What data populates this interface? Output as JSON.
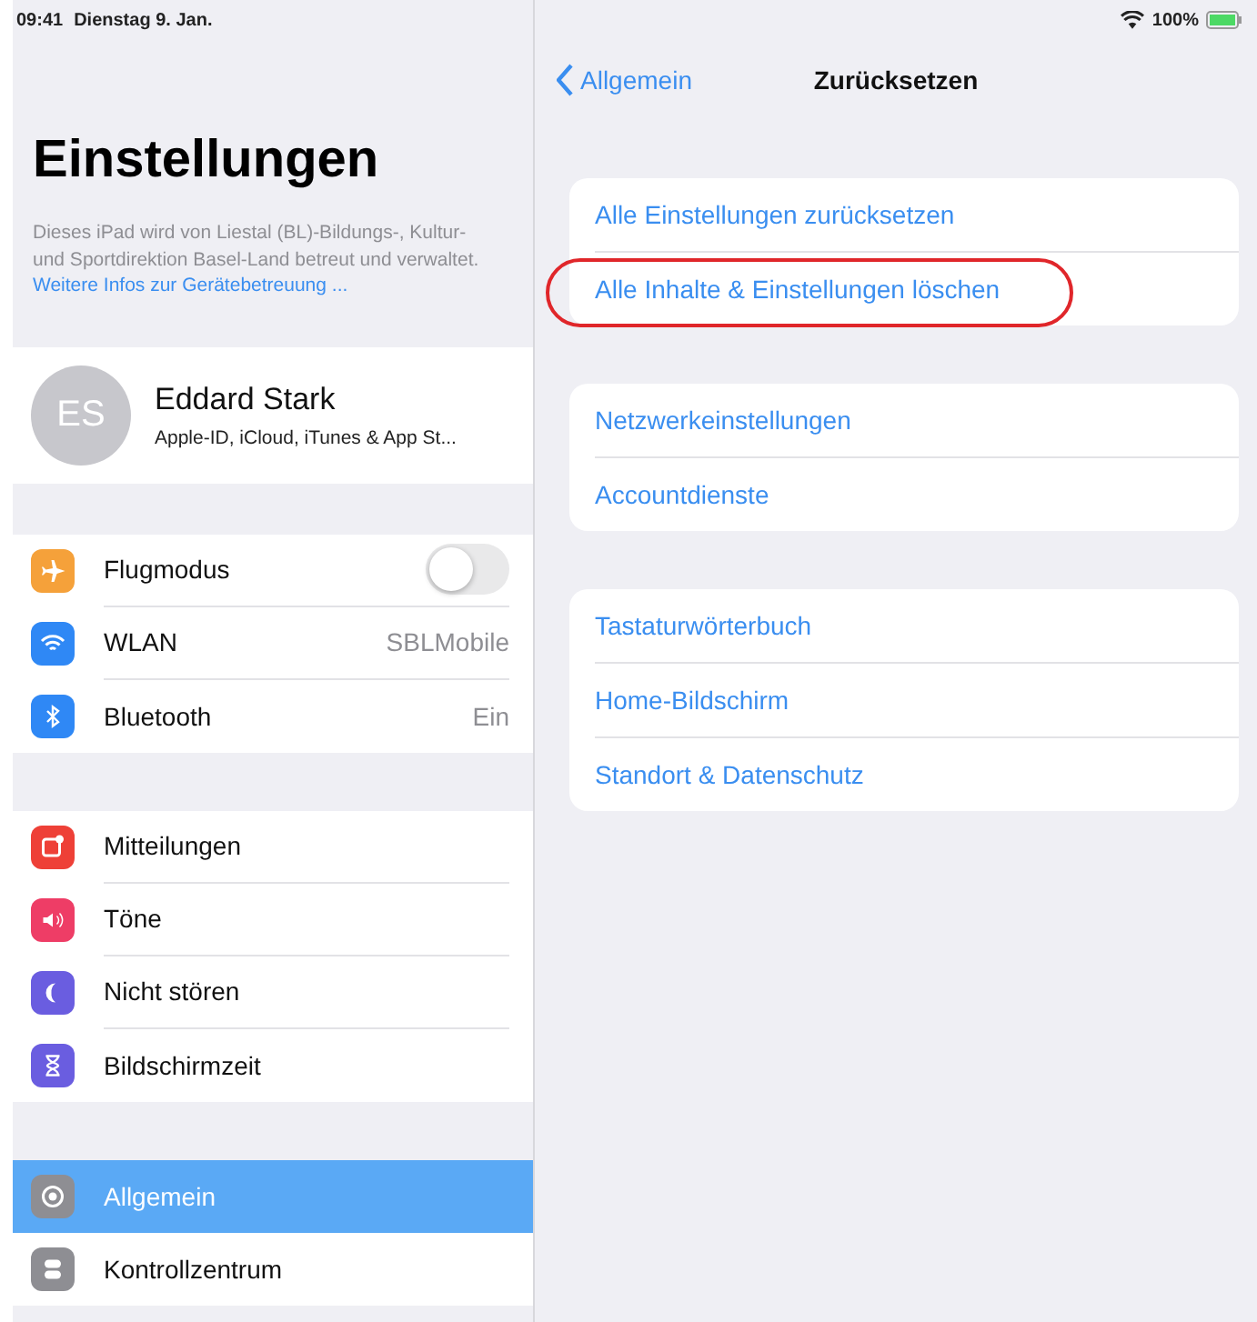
{
  "status_bar": {
    "time": "09:41",
    "date": "Dienstag 9. Jan.",
    "battery": "100%"
  },
  "sidebar": {
    "title": "Einstellungen",
    "notice": "Dieses iPad wird von Liestal (BL)-Bildungs-, Kultur-und Sportdirektion Basel-Land betreut und verwaltet.",
    "notice_link": "Weitere Infos zur Gerätebetreuung ...",
    "profile": {
      "initials": "ES",
      "name": "Eddard Stark",
      "subtitle": "Apple-ID, iCloud, iTunes & App St..."
    },
    "groups": [
      [
        {
          "label": "Flugmodus",
          "kind": "toggle",
          "on": false,
          "color": "#f5a13a",
          "selected": false
        },
        {
          "label": "WLAN",
          "kind": "value",
          "value": "SBLMobile",
          "color": "#2f88f5",
          "selected": false
        },
        {
          "label": "Bluetooth",
          "kind": "value",
          "value": "Ein",
          "color": "#2f88f5",
          "selected": false
        }
      ],
      [
        {
          "label": "Mitteilungen",
          "kind": "plain",
          "color": "#ee4037",
          "selected": false
        },
        {
          "label": "Töne",
          "kind": "plain",
          "color": "#ee3d66",
          "selected": false
        },
        {
          "label": "Nicht stören",
          "kind": "plain",
          "color": "#6a5de0",
          "selected": false
        },
        {
          "label": "Bildschirmzeit",
          "kind": "plain",
          "color": "#6a5de0",
          "selected": false
        }
      ],
      [
        {
          "label": "Allgemein",
          "kind": "plain",
          "color": "#8e8e93",
          "selected": true
        },
        {
          "label": "Kontrollzentrum",
          "kind": "plain",
          "color": "#8e8e93",
          "selected": false
        }
      ]
    ]
  },
  "detail": {
    "back": "Allgemein",
    "title": "Zurücksetzen",
    "groups": [
      [
        {
          "label": "Alle Einstellungen zurücksetzen",
          "highlighted": false
        },
        {
          "label": "Alle Inhalte & Einstellungen löschen",
          "highlighted": true
        }
      ],
      [
        {
          "label": "Netzwerkeinstellungen",
          "highlighted": false
        },
        {
          "label": "Accountdienste",
          "highlighted": false
        }
      ],
      [
        {
          "label": "Tastaturwörterbuch",
          "highlighted": false
        },
        {
          "label": "Home-Bildschirm",
          "highlighted": false
        },
        {
          "label": "Standort & Datenschutz",
          "highlighted": false
        }
      ]
    ]
  }
}
